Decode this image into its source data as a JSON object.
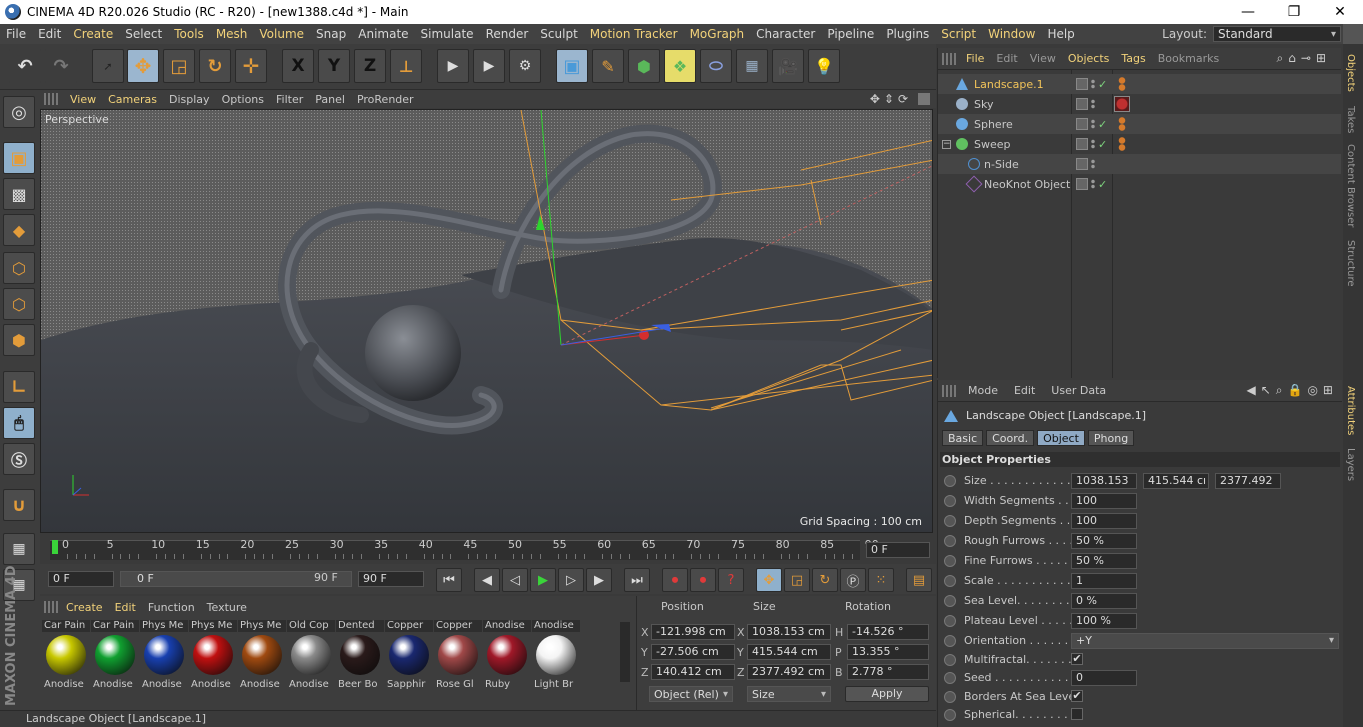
{
  "window": {
    "title": "CINEMA 4D R20.026 Studio (RC - R20) - [new1388.c4d *] - Main",
    "minimize": "—",
    "maximize": "❐",
    "close": "✕"
  },
  "menubar": {
    "items": [
      "File",
      "Edit",
      "Create",
      "Select",
      "Tools",
      "Mesh",
      "Volume",
      "Snap",
      "Animate",
      "Simulate",
      "Render",
      "Sculpt",
      "Motion Tracker",
      "MoGraph",
      "Character",
      "Pipeline",
      "Plugins",
      "Script",
      "Window",
      "Help"
    ],
    "layout_label": "Layout:",
    "layout_value": "Standard"
  },
  "toolbar": {
    "x_label": "X",
    "y_label": "Y",
    "z_label": "Z"
  },
  "viewport": {
    "menu": [
      "View",
      "Cameras",
      "Display",
      "Options",
      "Filter",
      "Panel",
      "ProRender"
    ],
    "label": "Perspective",
    "grid_spacing": "Grid Spacing : 100 cm"
  },
  "timeline": {
    "ticks": [
      "0",
      "5",
      "10",
      "15",
      "20",
      "25",
      "30",
      "35",
      "40",
      "45",
      "50",
      "55",
      "60",
      "65",
      "70",
      "75",
      "80",
      "85",
      "90"
    ],
    "current_frame": "0 F"
  },
  "transport": {
    "start": "0 F",
    "range_start": "0 F",
    "range_end": "90 F",
    "end": "90 F"
  },
  "materials": {
    "menu": [
      "Create",
      "Edit",
      "Function",
      "Texture"
    ],
    "items": [
      {
        "top": "Car Pain",
        "bottom": "Anodise",
        "color": "#c8c800"
      },
      {
        "top": "Car Pain",
        "bottom": "Anodise",
        "color": "#10a030"
      },
      {
        "top": "Phys Me",
        "bottom": "Anodise",
        "color": "#1840b0"
      },
      {
        "top": "Phys Me",
        "bottom": "Anodise",
        "color": "#c01010"
      },
      {
        "top": "Phys Me",
        "bottom": "Anodise",
        "color": "#a04a10"
      },
      {
        "top": "Old Cop",
        "bottom": "Anodise",
        "color": "#8a8a8a"
      },
      {
        "top": "Dented",
        "bottom": "Beer Bo",
        "color": "#2a1a1a"
      },
      {
        "top": "Copper",
        "bottom": "Sapphir",
        "color": "#1a2870"
      },
      {
        "top": "Copper",
        "bottom": "Rose Gl",
        "color": "#a04848"
      },
      {
        "top": "Anodise",
        "bottom": "Ruby",
        "color": "#a01828"
      },
      {
        "top": "Anodise",
        "bottom": "Light Br",
        "color": "#f4f4f4"
      }
    ]
  },
  "coords": {
    "headers": {
      "position": "Position",
      "size": "Size",
      "rotation": "Rotation"
    },
    "axes": [
      "X",
      "Y",
      "Z"
    ],
    "rot_axes": [
      "H",
      "P",
      "B"
    ],
    "position": [
      "-121.998 cm",
      "-27.506 cm",
      "140.412 cm"
    ],
    "size": [
      "1038.153 cm",
      "415.544 cm",
      "2377.492 cm"
    ],
    "rotation": [
      "-14.526 °",
      "13.355 °",
      "2.778 °"
    ],
    "mode": "Object (Rel)",
    "size_mode": "Size",
    "apply": "Apply"
  },
  "objects": {
    "menu": [
      "File",
      "Edit",
      "View",
      "Objects",
      "Tags",
      "Bookmarks"
    ],
    "rows": [
      {
        "name": "Landscape.1",
        "color": "#6aa8e0"
      },
      {
        "name": "Sky",
        "color": "#9ab0c8"
      },
      {
        "name": "Sphere",
        "color": "#6aa8e0"
      },
      {
        "name": "Sweep",
        "color": "#60c060"
      },
      {
        "name": "n-Side",
        "color": "#5090d0"
      },
      {
        "name": "NeoKnot Object",
        "color": "#9060b0"
      }
    ]
  },
  "sidetabs": {
    "top": [
      "Objects",
      "Takes",
      "Content Browser",
      "Structure"
    ],
    "bottom": [
      "Attributes",
      "Layers"
    ]
  },
  "attributes": {
    "menu": [
      "Mode",
      "Edit",
      "User Data"
    ],
    "title": "Landscape Object [Landscape.1]",
    "tabs": [
      "Basic",
      "Coord.",
      "Object",
      "Phong"
    ],
    "section": "Object Properties",
    "size_label": "Size . . . . . . . . . . . . .",
    "size_values": [
      "1038.153",
      "415.544 cı",
      "2377.492"
    ],
    "rows": [
      {
        "label": "Width Segments . . .",
        "value": "100"
      },
      {
        "label": "Depth Segments . . .",
        "value": "100"
      },
      {
        "label": "Rough Furrows . . . .",
        "value": "50 %"
      },
      {
        "label": "Fine Furrows . . . . . .",
        "value": "50 %"
      },
      {
        "label": "Scale . . . . . . . . . . . .",
        "value": "1"
      },
      {
        "label": "Sea Level. . . . . . . . .",
        "value": "0 %"
      },
      {
        "label": "Plateau Level . . . . .",
        "value": "100 %"
      }
    ],
    "orientation_label": "Orientation . . . . . . . .",
    "orientation_value": "+Y",
    "multifractal_label": "Multifractal. . . . . . . .",
    "multifractal_check": "✔",
    "seed_label": "Seed . . . . . . . . . . . . .",
    "seed_value": "0",
    "borders_label": "Borders At Sea Level",
    "borders_check": "✔",
    "spherical_label": "Spherical. . . . . . . . . ."
  },
  "status": "Landscape Object [Landscape.1]"
}
